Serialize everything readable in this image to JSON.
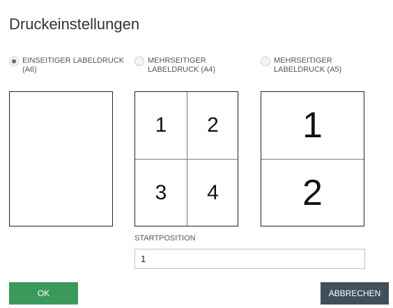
{
  "dialog": {
    "title": "Druckeinstellungen"
  },
  "options": [
    {
      "label_line1": "EINSEITIGER LABELDRUCK",
      "label_line2": "(A6)",
      "selected": true
    },
    {
      "label_line1": "MEHRSEITIGER",
      "label_line2": "LABELDRUCK (A4)",
      "selected": false
    },
    {
      "label_line1": "MEHRSEITIGER",
      "label_line2": "LABELDRUCK (A5)",
      "selected": false
    }
  ],
  "previews": {
    "a4_cells": [
      "1",
      "2",
      "3",
      "4"
    ],
    "a5_cells": [
      "1",
      "2"
    ]
  },
  "start_position": {
    "label": "STARTPOSITION",
    "value": "1"
  },
  "buttons": {
    "ok": "OK",
    "cancel": "ABBRECHEN"
  },
  "colors": {
    "ok_button": "#3b9a5b",
    "cancel_button": "#3e4f5d"
  }
}
